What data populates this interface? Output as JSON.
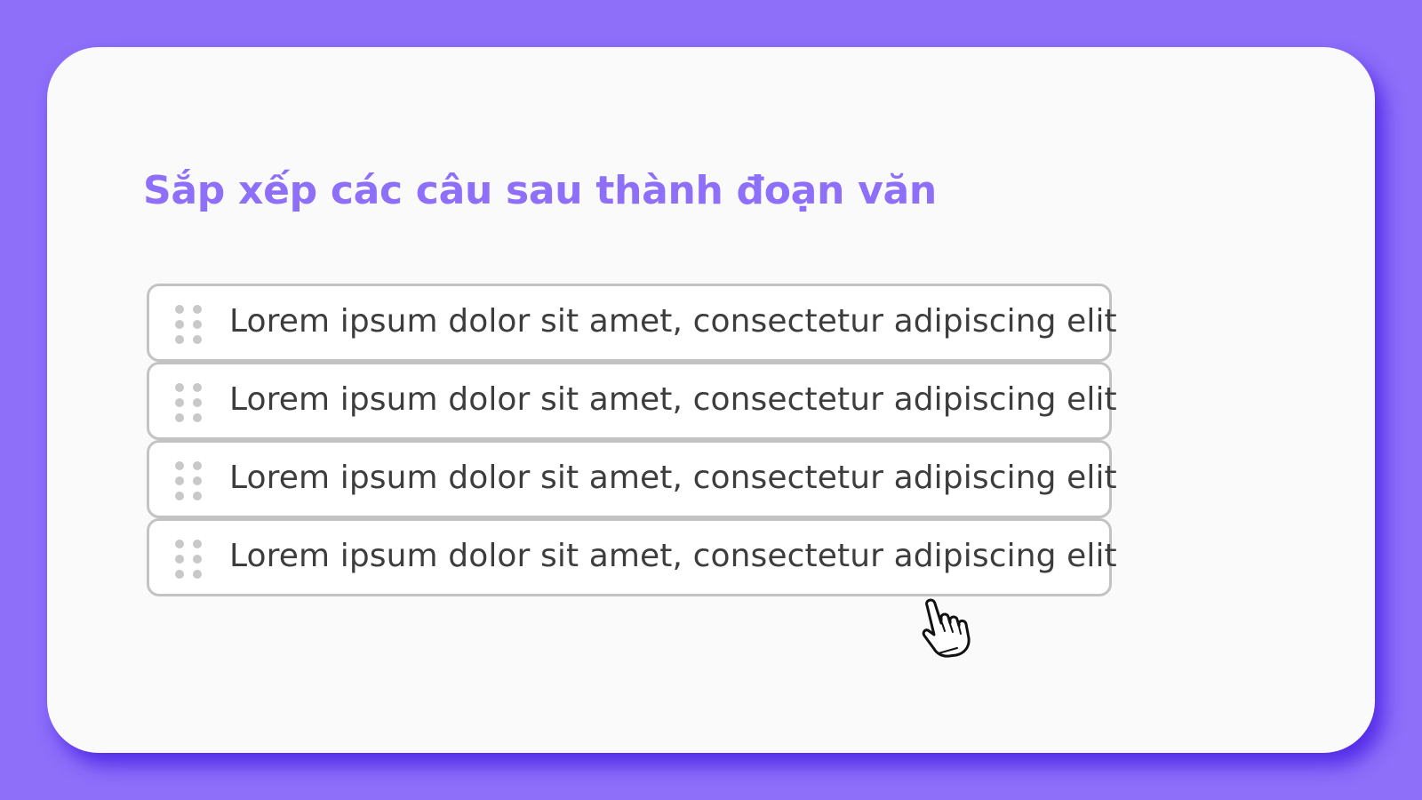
{
  "exercise": {
    "title": "Sắp xếp các câu sau thành đoạn văn",
    "items": [
      {
        "label": "Lorem ipsum dolor sit amet, consectetur adipiscing elit",
        "handle_icon": "drag-handle-icon"
      },
      {
        "label": "Lorem ipsum dolor sit amet, consectetur adipiscing elit",
        "handle_icon": "drag-handle-icon"
      },
      {
        "label": "Lorem ipsum dolor sit amet, consectetur adipiscing elit",
        "handle_icon": "drag-handle-icon"
      },
      {
        "label": "Lorem ipsum dolor sit amet, consectetur adipiscing elit",
        "handle_icon": "drag-handle-icon"
      }
    ]
  },
  "pointer": {
    "icon": "hand-pointer-icon"
  },
  "colors": {
    "background": "#8d6ffa",
    "card": "#fafafa",
    "title": "#8d6ffa",
    "item_border": "#c3c3c3",
    "item_text": "#3d3d3d",
    "handle": "#c8c8c8"
  }
}
